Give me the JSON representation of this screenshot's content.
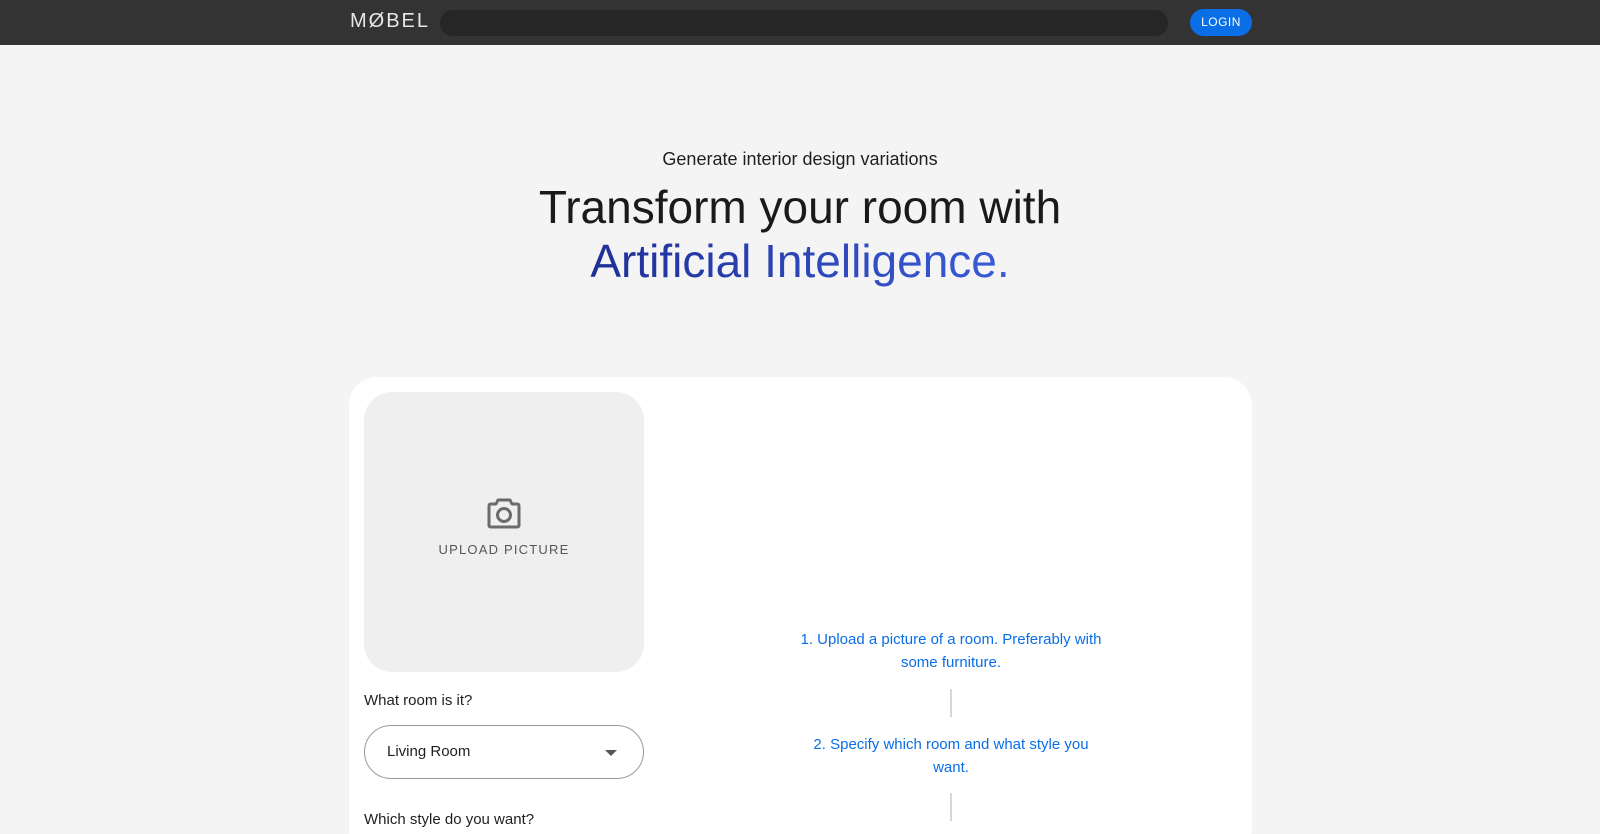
{
  "nav": {
    "logo": "MØBEL",
    "search_placeholder": "",
    "login_label": "LOGIN"
  },
  "hero": {
    "kicker": "Generate interior design variations",
    "headline_line1": "Transform your room with",
    "headline_line2": "Artificial Intelligence."
  },
  "form": {
    "upload_label": "UPLOAD PICTURE",
    "room_question": "What room is it?",
    "room_selected": "Living Room",
    "style_question": "Which style do you want?"
  },
  "steps": [
    {
      "text": "1. Upload a picture of a room. Preferably with some furniture."
    },
    {
      "text": "2. Specify which room and what style you want."
    }
  ],
  "colors": {
    "topbar": "#333333",
    "accent": "#0a6ee6",
    "headline_gradient_start": "#1f2f96",
    "headline_gradient_end": "#3a5cd8"
  }
}
